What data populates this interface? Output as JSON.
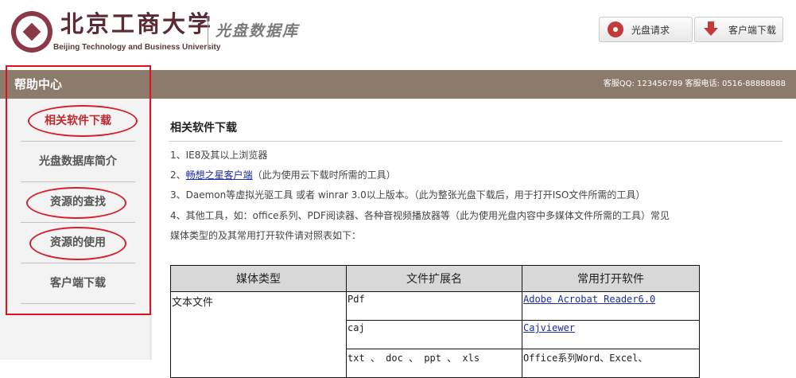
{
  "header": {
    "university_cn": "北京工商大学",
    "university_en": "Beijing Technology and Business University",
    "site_title": "光盘数据库",
    "buttons": [
      {
        "label": "光盘请求",
        "icon": "disc-icon"
      },
      {
        "label": "客户端下载",
        "icon": "download-arrow-icon"
      }
    ]
  },
  "topbar": {
    "help_center": "帮助中心",
    "service_text": "客服QQ: 123456789 客服电话: 0516-88888888"
  },
  "sidebar": {
    "items": [
      {
        "label": "相关软件下载",
        "active": true
      },
      {
        "label": "光盘数据库简介",
        "active": false
      },
      {
        "label": "资源的查找",
        "active": false
      },
      {
        "label": "资源的使用",
        "active": false
      },
      {
        "label": "客户端下载",
        "active": false
      }
    ]
  },
  "content": {
    "title": "相关软件下载",
    "lines": [
      {
        "prefix": "1、IE8及其以上浏览器",
        "link": "",
        "suffix": ""
      },
      {
        "prefix": "2、",
        "link": "畅想之星客户端",
        "suffix": "（此为使用云下载时所需的工具）"
      },
      {
        "prefix": "3、Daemon等虚拟光驱工具 或者 winrar 3.0以上版本。（此为整张光盘下载后，用于打开ISO文件所需的工具）",
        "link": "",
        "suffix": ""
      },
      {
        "prefix": "4、其他工具，如：office系列、PDF阅读器、各种音视频播放器等（此为使用光盘内容中多媒体文件所需的工具）常见",
        "link": "",
        "suffix": ""
      },
      {
        "prefix": "媒体类型的及其常用打开软件请对照表如下：",
        "link": "",
        "suffix": ""
      }
    ],
    "table": {
      "headers": [
        "媒体类型",
        "文件扩展名",
        "常用打开软件"
      ],
      "rows": [
        {
          "type": "文本文件",
          "ext": "Pdf",
          "software": "Adobe Acrobat Reader6.0",
          "is_link": true
        },
        {
          "type": "",
          "ext": "caj",
          "software": "Cajviewer",
          "is_link": true
        },
        {
          "type": "",
          "ext": "txt 、 doc 、 ppt 、 xls",
          "software": "Office系列Word、Excel、",
          "is_link": false
        }
      ]
    }
  },
  "colors": {
    "topbar": "#8c7b6b",
    "accent_red": "#c0282c",
    "highlight_red": "#e0101e",
    "link_blue": "#1a2ca8",
    "sidebar_bg": "#f3f3f3"
  }
}
